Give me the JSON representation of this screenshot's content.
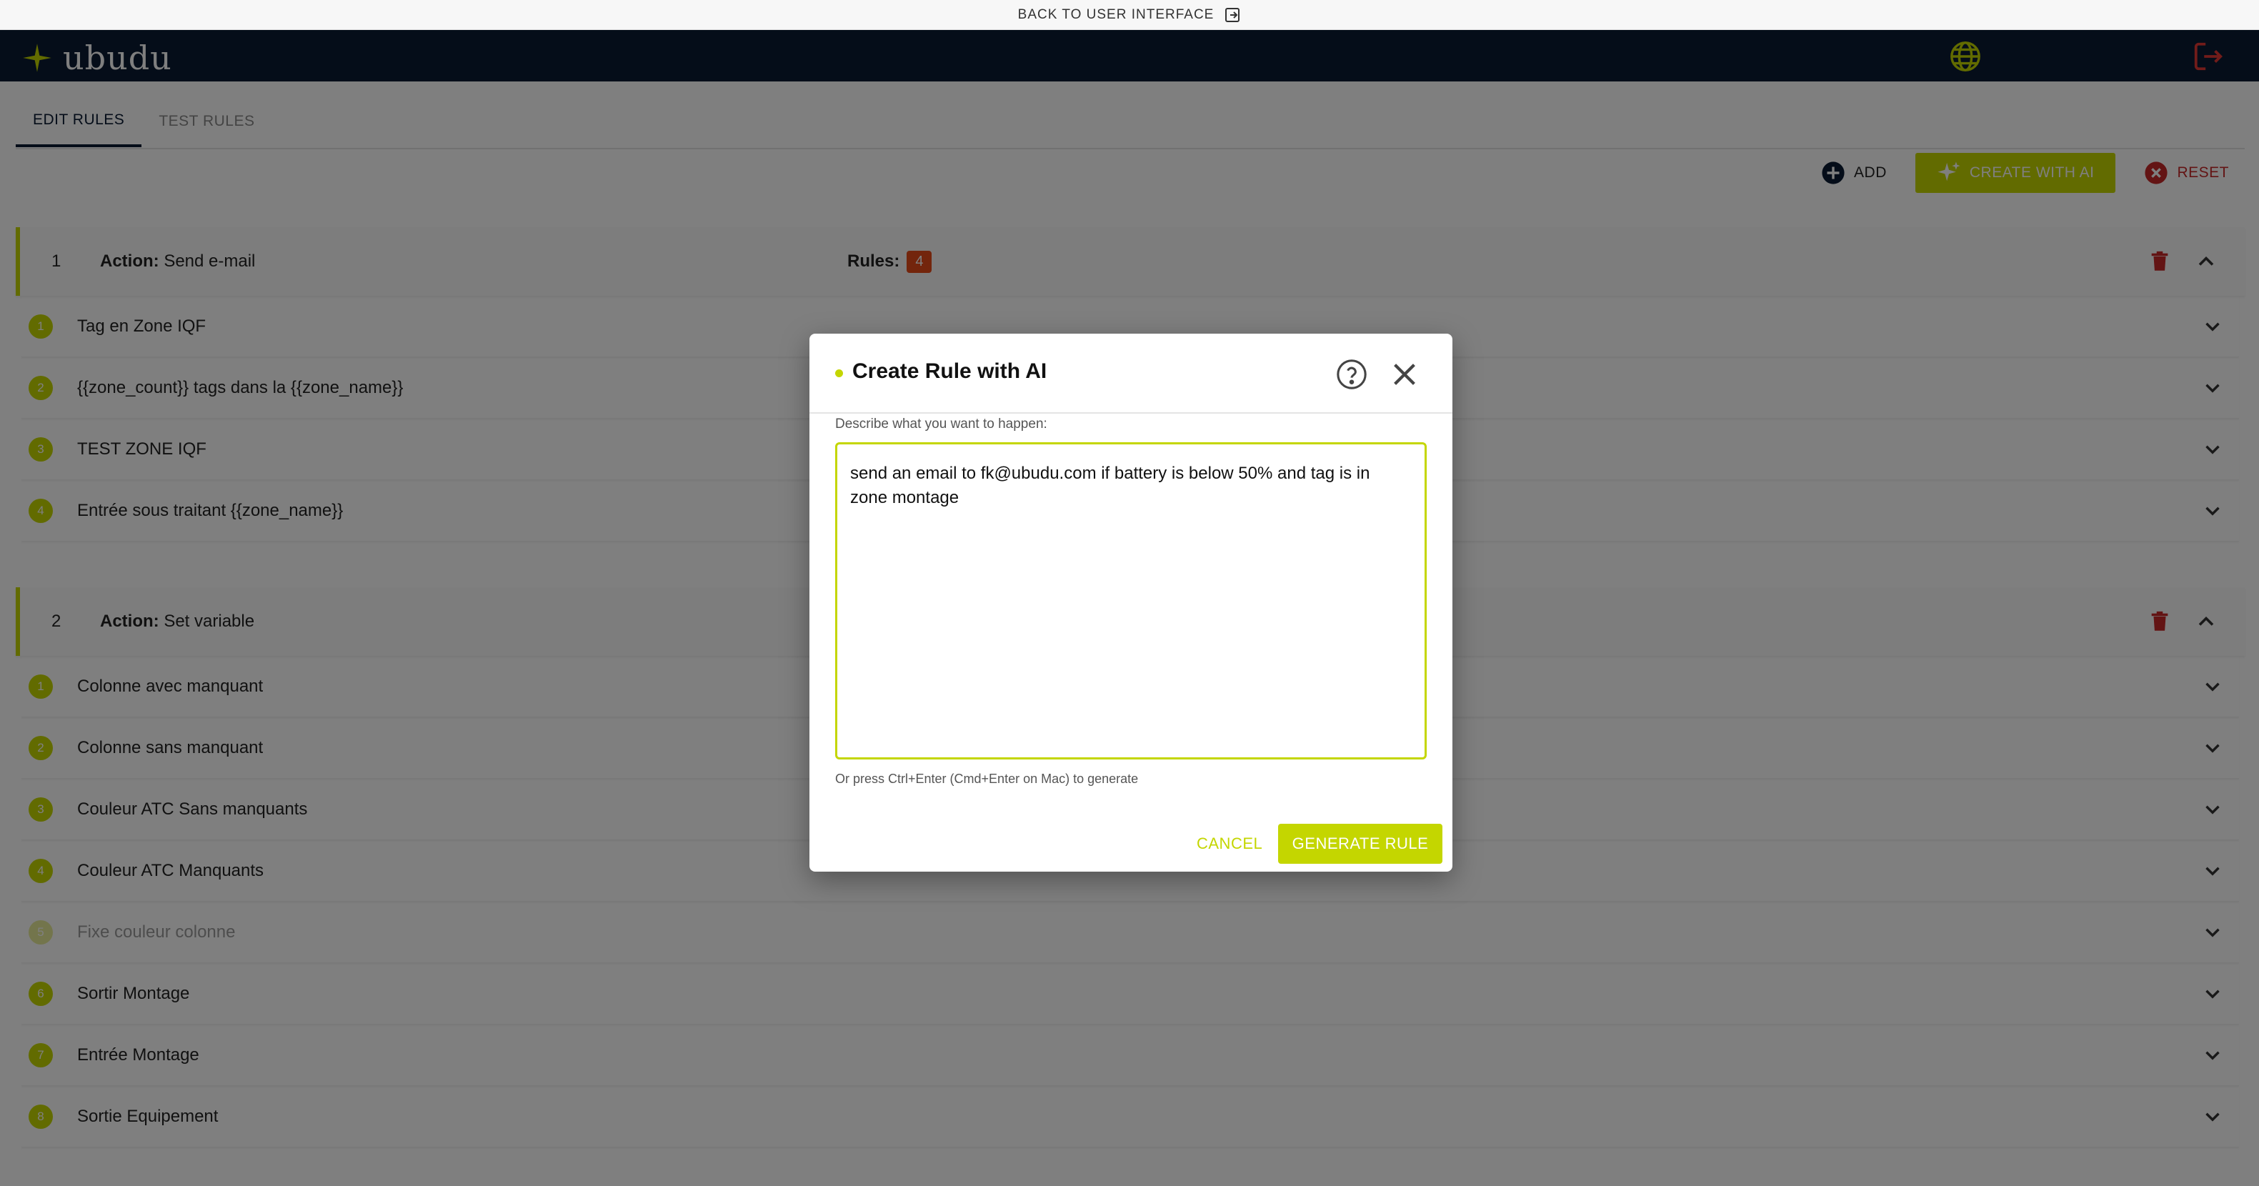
{
  "topbar": {
    "back_label": "BACK TO USER INTERFACE"
  },
  "header": {
    "logo_text": "ubudu"
  },
  "tabs": [
    {
      "label": "EDIT RULES",
      "active": true
    },
    {
      "label": "TEST RULES",
      "active": false
    }
  ],
  "toolbar": {
    "add_label": "ADD",
    "create_ai_label": "CREATE WITH AI",
    "reset_label": "RESET"
  },
  "groups": [
    {
      "number": "1",
      "action_prefix": "Action:",
      "action_value": "Send e-mail",
      "rules_label": "Rules:",
      "rules_count": "4",
      "rules": [
        {
          "number": "1",
          "label": "Tag en Zone IQF"
        },
        {
          "number": "2",
          "label": "{{zone_count}} tags dans la {{zone_name}}"
        },
        {
          "number": "3",
          "label": "TEST ZONE IQF"
        },
        {
          "number": "4",
          "label": "Entrée sous traitant {{zone_name}}"
        }
      ]
    },
    {
      "number": "2",
      "action_prefix": "Action:",
      "action_value": "Set variable",
      "rules": [
        {
          "number": "1",
          "label": "Colonne avec manquant"
        },
        {
          "number": "2",
          "label": "Colonne sans manquant"
        },
        {
          "number": "3",
          "label": "Couleur ATC Sans manquants"
        },
        {
          "number": "4",
          "label": "Couleur ATC Manquants"
        },
        {
          "number": "5",
          "label": "Fixe couleur colonne",
          "disabled": true
        },
        {
          "number": "6",
          "label": "Sortir Montage"
        },
        {
          "number": "7",
          "label": "Entrée Montage"
        },
        {
          "number": "8",
          "label": "Sortie Equipement"
        }
      ]
    }
  ],
  "dialog": {
    "title": "Create Rule with AI",
    "prompt_label": "Describe what you want to happen:",
    "prompt_value": "send an email to fk@ubudu.com if battery is below 50% and tag is in zone montage ",
    "hint": "Or press Ctrl+Enter (Cmd+Enter on Mac) to generate",
    "cancel_label": "CANCEL",
    "generate_label": "GENERATE RULE"
  },
  "colors": {
    "accent": "#c4d600",
    "navy": "#0a1b33",
    "danger": "#c62828",
    "badge": "#e64a19"
  },
  "icons": [
    "exit-icon",
    "logo-star-icon",
    "globe-icon",
    "logout-icon",
    "plus-circle-icon",
    "sparkle-icon",
    "close-circle-icon",
    "trash-icon",
    "chevron-up-icon",
    "chevron-down-icon",
    "help-icon",
    "close-icon"
  ]
}
